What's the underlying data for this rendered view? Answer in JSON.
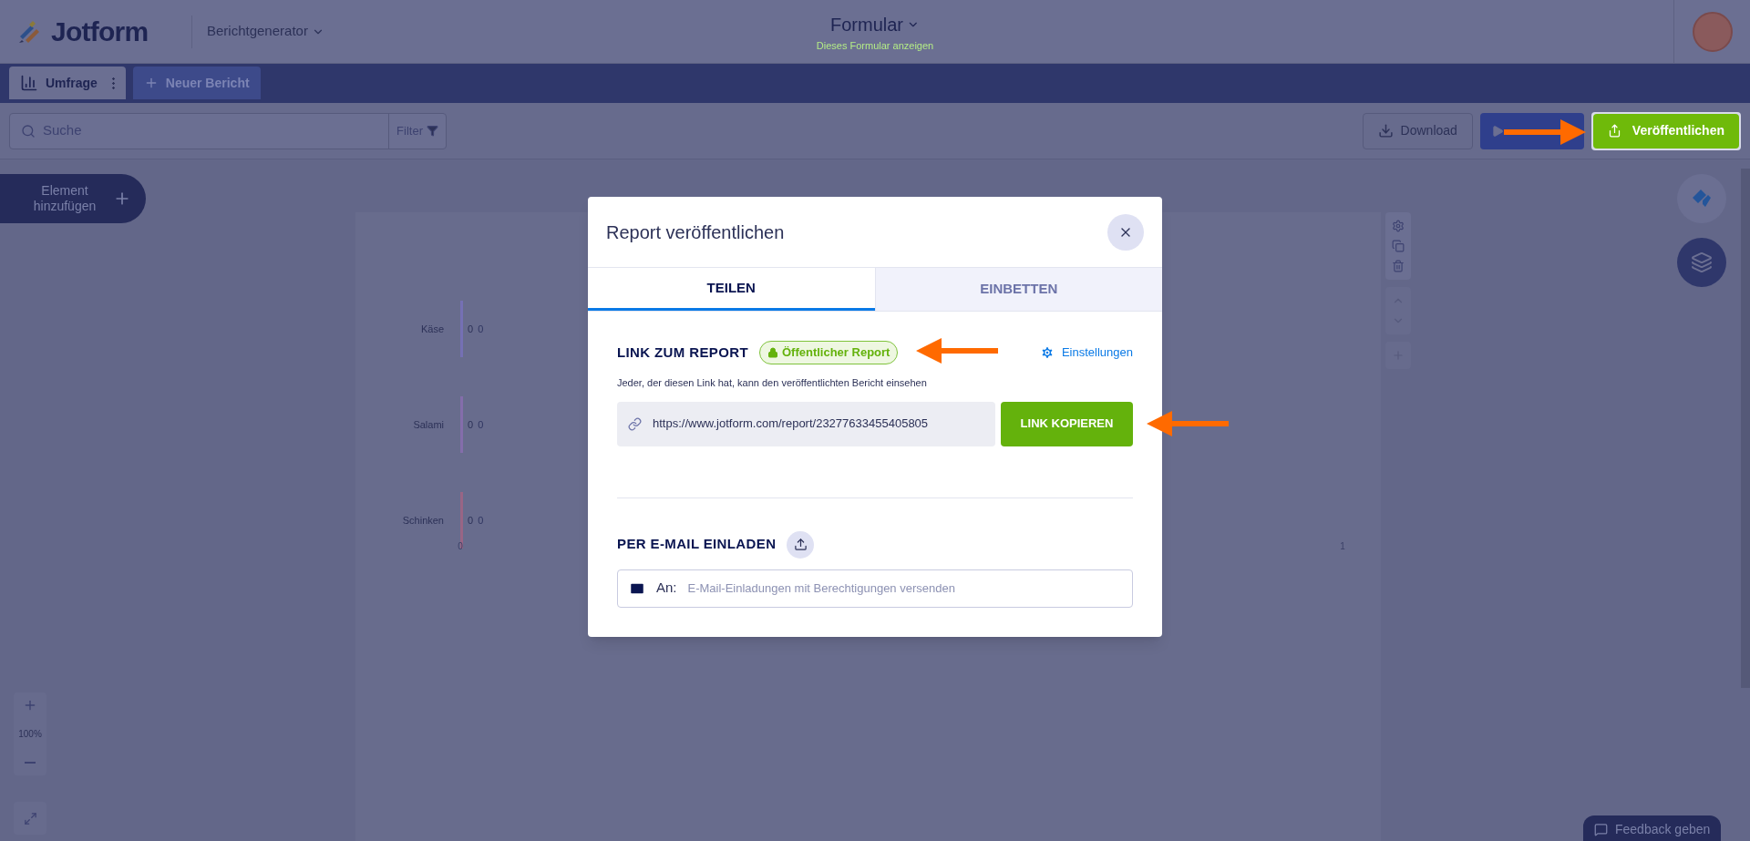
{
  "header": {
    "logo": "Jotform",
    "app_menu": "Berichtgenerator",
    "form_title": "Formular",
    "form_link": "Dieses Formular anzeigen"
  },
  "tabs": [
    {
      "label": "Umfrage",
      "selected": true
    },
    {
      "label": "Neuer Bericht",
      "selected": false
    }
  ],
  "toolbar": {
    "search": {
      "placeholder": "Suche"
    },
    "filter": "Filter",
    "download": "Download",
    "publish": "Veröffentlichen"
  },
  "add_element": "Element hinzufügen",
  "zoom": {
    "reading": "100%"
  },
  "feedback": "Feedback geben",
  "chart": {
    "chart_data": {
      "type": "bar",
      "orientation": "horizontal",
      "categories": [
        "Käse",
        "Salami",
        "Schinken"
      ],
      "series": [
        {
          "color": "#7f74d6",
          "values": [
            0,
            null,
            null
          ]
        },
        {
          "color": "#9a6fc4",
          "values": [
            null,
            0,
            null
          ]
        },
        {
          "color": "#c0607f",
          "values": [
            null,
            null,
            0
          ]
        }
      ],
      "value_labels": [
        [
          "0",
          "0"
        ],
        [
          "0",
          "0"
        ],
        [
          "0",
          "0"
        ]
      ],
      "xlim": [
        0,
        1
      ],
      "xticks": [
        0,
        1
      ]
    }
  },
  "dialog": {
    "title": "Report veröffentlichen",
    "tabs": [
      {
        "label": "TEILEN",
        "selected": true
      },
      {
        "label": "EINBETTEN",
        "selected": false
      }
    ],
    "link_heading": "LINK ZUM REPORT",
    "status_badge": "Öffentlicher Report",
    "settings_link": "Einstellungen",
    "description": "Jeder, der diesen Link hat, kann den veröffentlichten Bericht einsehen",
    "url": "https://www.jotform.com/report/23277633455405805",
    "copy_button": "LINK KOPIEREN",
    "email_heading": "PER E-MAIL EINLADEN",
    "email_field": {
      "label": "An:",
      "placeholder": "E-Mail-Einladungen mit Berechtigungen versenden"
    }
  },
  "annotation_arrows": [
    {
      "kind": "arrow"
    },
    {
      "kind": "arrow"
    },
    {
      "kind": "arrow"
    }
  ]
}
